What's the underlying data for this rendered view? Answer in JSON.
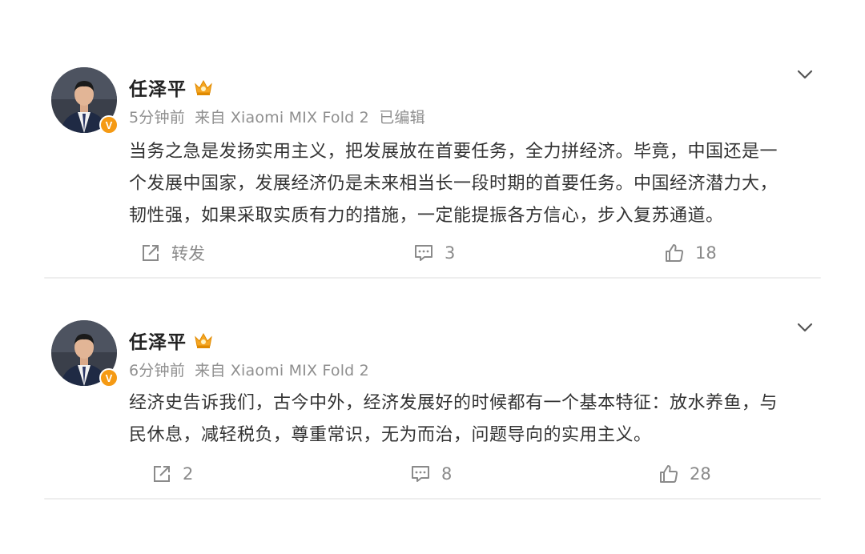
{
  "colors": {
    "name": "#222222",
    "meta": "#8f8f8f",
    "body": "#333333",
    "action": "#8a8a8a",
    "verified_badge": "#f59a14"
  },
  "posts": [
    {
      "author": "任泽平",
      "verified_badge": "V",
      "time": "5分钟前",
      "source": "来自 Xiaomi MIX Fold 2",
      "edited": "已编辑",
      "text_lines": [
        "当务之急是发扬实用主义，把发展放在首要任务，全力拼经济。毕竟，中国还是一",
        "个发展中国家，发展经济仍是未来相当长一段时期的首要任务。中国经济潜力大，",
        "韧性强，如果采取实质有力的措施，一定能提振各方信心，步入复苏通道。"
      ],
      "repost": "转发",
      "comments": "3",
      "likes": "18",
      "icons": {
        "repost": "share-icon",
        "comment": "comment-icon",
        "like": "thumbs-up-icon",
        "menu": "chevron-down-icon",
        "badge": "crown-icon"
      }
    },
    {
      "author": "任泽平",
      "verified_badge": "V",
      "time": "6分钟前",
      "source": "来自 Xiaomi MIX Fold 2",
      "edited": "",
      "text_lines": [
        "经济史告诉我们，古今中外，经济发展好的时候都有一个基本特征：放水养鱼，与",
        "民休息，减轻税负，尊重常识，无为而治，问题导向的实用主义。"
      ],
      "repost": "2",
      "comments": "8",
      "likes": "28",
      "icons": {
        "repost": "share-icon",
        "comment": "comment-icon",
        "like": "thumbs-up-icon",
        "menu": "chevron-down-icon",
        "badge": "crown-icon"
      }
    }
  ]
}
